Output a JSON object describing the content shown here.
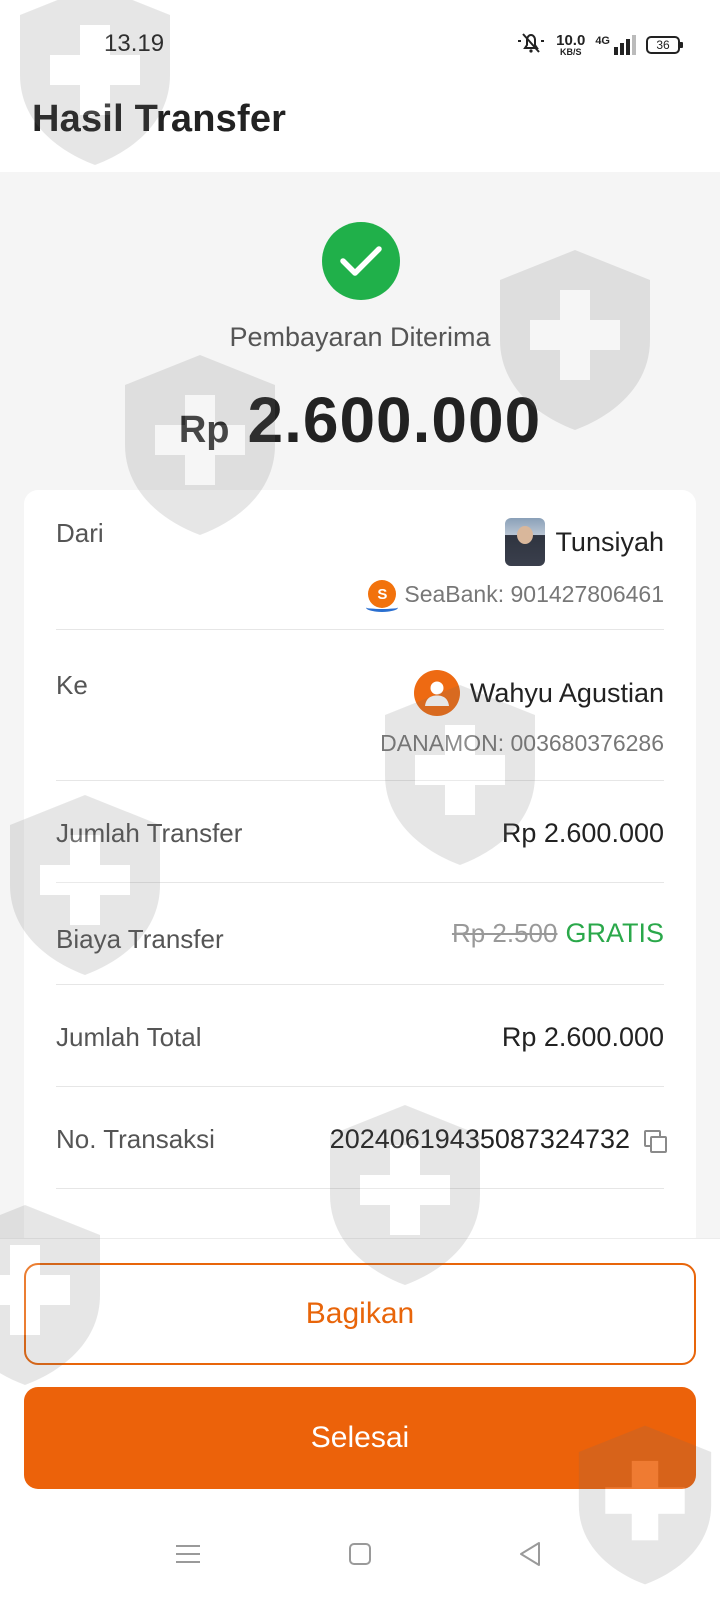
{
  "status_bar": {
    "time": "13.19",
    "net_speed_value": "10.0",
    "net_speed_unit": "KB/S",
    "network": "4G",
    "battery": "36"
  },
  "header": {
    "title": "Hasil Transfer"
  },
  "result": {
    "status": "Pembayaran Diterima",
    "currency": "Rp",
    "amount": "2.600.000",
    "success_color": "#20b04a"
  },
  "details": {
    "from": {
      "label": "Dari",
      "name": "Tunsiyah",
      "account": "SeaBank: 901427806461",
      "bank_icon_letter": "S"
    },
    "to": {
      "label": "Ke",
      "name": "Wahyu Agustian",
      "account": "DANAMON: 003680376286"
    },
    "transfer_amount": {
      "label": "Jumlah Transfer",
      "value": "Rp 2.600.000"
    },
    "transfer_fee": {
      "label": "Biaya Transfer",
      "original": "Rp 2.500",
      "value": "GRATIS"
    },
    "total": {
      "label": "Jumlah Total",
      "value": "Rp 2.600.000"
    },
    "transaction": {
      "label": "No. Transaksi",
      "value": "20240619435087324732"
    }
  },
  "actions": {
    "share_label": "Bagikan",
    "done_label": "Selesai",
    "accent_color": "#ec620a"
  },
  "icons": {
    "success": "check-circle-icon",
    "copy": "copy-icon",
    "avatar": "person-icon",
    "nav": [
      "menu-icon",
      "home-square-icon",
      "back-triangle-icon"
    ]
  }
}
